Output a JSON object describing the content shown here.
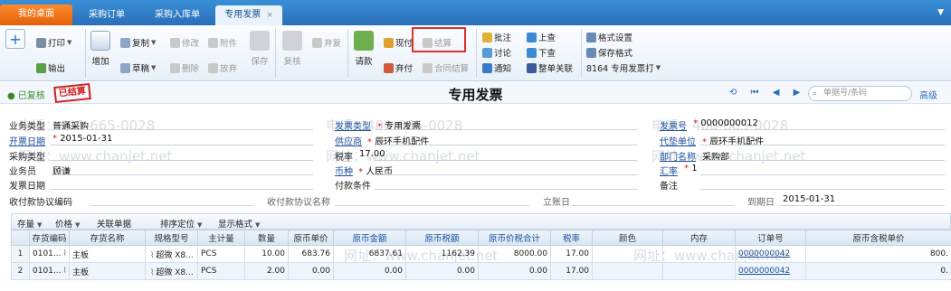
{
  "tabs": [
    {
      "label": "我的桌面"
    },
    {
      "label": "采购订单"
    },
    {
      "label": "采购入库单"
    },
    {
      "label": "专用发票",
      "close": "×"
    }
  ],
  "tab_menu": "▼",
  "toolbar": {
    "add": "+",
    "print": "打印",
    "export": "输出",
    "increase": "增加",
    "copy": "复制",
    "modify": "修改",
    "attach": "附件",
    "draft": "草稿",
    "delete": "删除",
    "abandon": "放弃",
    "save": "保存",
    "review": "复核",
    "abandon_review": "弃复",
    "request_payment": "请款",
    "cash": "现付",
    "abandon_pay": "弃付",
    "settle": "结算",
    "merge_settle": "合同结算",
    "approve": "批注",
    "discuss": "讨论",
    "notify": "通知",
    "prev": "上查",
    "next": "下查",
    "full_link": "整单关联",
    "format_set": "格式设置",
    "save_format": "保存格式",
    "print_template": "8164 专用发票打",
    "colors": {
      "highlight": "#e0302a",
      "tab_active": "#eaf3fb",
      "home_tab": "#ff8a2a"
    }
  },
  "header": {
    "status": "已复核",
    "stamp": "已结算",
    "title": "专用发票",
    "search_placeholder": "单据号/条码",
    "advanced": "高级",
    "nav": "⟲ ⏮ ◀ ▶ ⏭"
  },
  "watermark": {
    "phone": "电话：400-665-0028",
    "site": "网址：www.chanjet.net"
  },
  "form": {
    "business_type_label": "业务类型",
    "business_type": "普通采购",
    "invoice_type_label": "发票类型",
    "invoice_type": "专用发票",
    "invoice_no_label": "发票号",
    "invoice_no": "0000000012",
    "invoice_date_label": "开票日期",
    "invoice_date": "2015-01-31",
    "supplier_label": "供应商",
    "supplier": "辰环手机配件",
    "agent_label": "代垫单位",
    "agent": "辰环手机配件",
    "purchase_type_label": "采购类型",
    "purchase_type": "",
    "tax_rate_label": "税率",
    "tax_rate": "17.00",
    "dept_label": "部门名称",
    "dept": "采购部",
    "salesman_label": "业务员",
    "salesman": "顾谦",
    "currency_label": "币种",
    "currency": "人民币",
    "exch_rate_label": "汇率",
    "exch_rate": "1",
    "issue_date_label": "发票日期",
    "issue_date": "",
    "pay_terms_label": "付款条件",
    "pay_terms": "",
    "remark_label": "备注",
    "remark": "",
    "agreement_code_label": "收付款协议编码",
    "agreement_name_label": "收付款协议名称",
    "account_date_label": "立账日",
    "due_date_label": "到期日",
    "due_date": "2015-01-31"
  },
  "grid_toolbar": {
    "stock": "存量",
    "price": "价格",
    "related": "关联单据",
    "sort": "排序定位",
    "display": "显示格式"
  },
  "grid": {
    "columns": [
      "",
      "存货编码",
      "存货名称",
      "规格型号",
      "主计量",
      "数量",
      "原币单价",
      "原币金额",
      "原币税额",
      "原币价税合计",
      "税率",
      "颜色",
      "内存",
      "订单号",
      "原币含税单价"
    ],
    "rows": [
      {
        "idx": "1",
        "code": "0101...",
        "name": "主板",
        "spec": "超微 X8...",
        "unit": "PCS",
        "qty": "10.00",
        "price": "683.76",
        "amount": "6837.61",
        "tax": "1162.39",
        "total": "8000.00",
        "rate": "17.00",
        "color": "",
        "memory": "",
        "order": "0000000042",
        "taxprice": "800."
      },
      {
        "idx": "2",
        "code": "0101...",
        "name": "主板",
        "spec": "超微 X8...",
        "unit": "PCS",
        "qty": "2.00",
        "price": "0.00",
        "amount": "0.00",
        "tax": "0.00",
        "total": "0.00",
        "rate": "17.00",
        "color": "",
        "memory": "",
        "order": "0000000042",
        "taxprice": "0."
      }
    ]
  }
}
